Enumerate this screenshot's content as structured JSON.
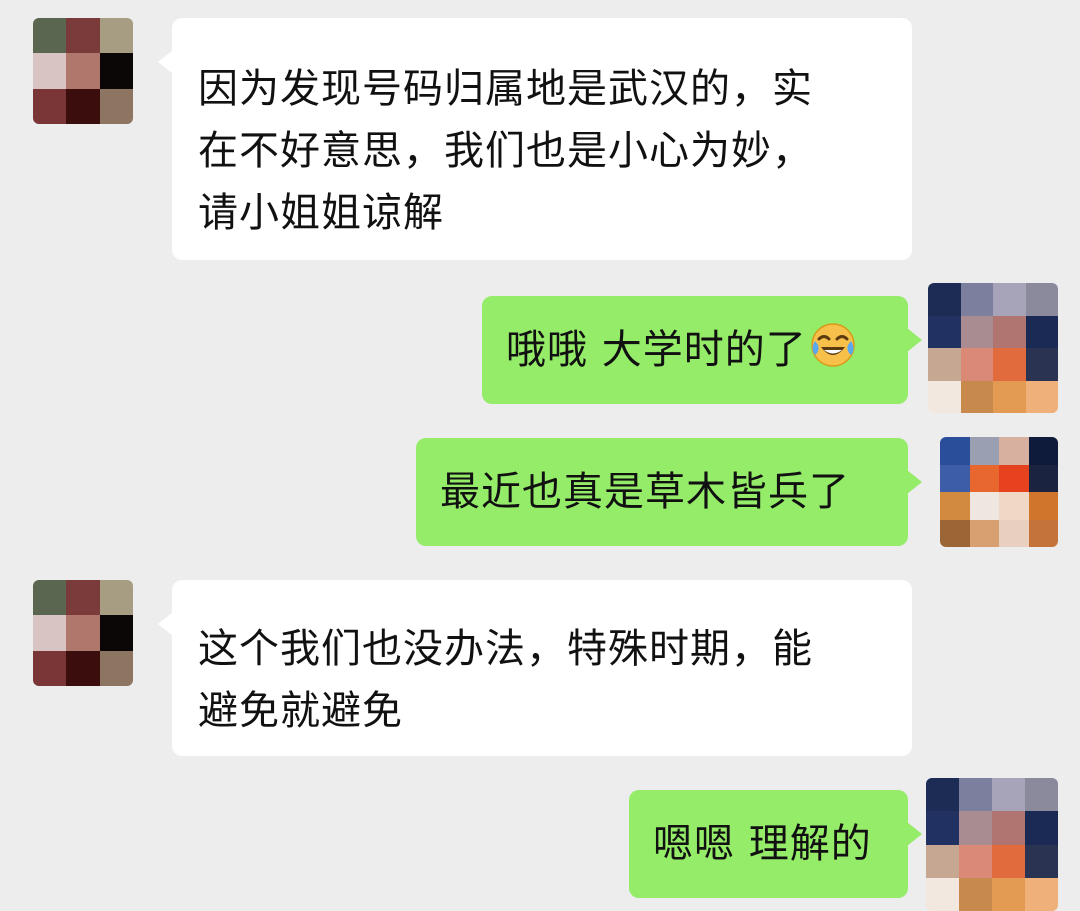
{
  "messages": [
    {
      "direction": "incoming",
      "lines": [
        "因为发现号码归属地是武汉的，实",
        "在不好意思，我们也是小心为妙，",
        "请小姐姐谅解"
      ]
    },
    {
      "direction": "outgoing",
      "text": "哦哦 大学时的了",
      "emoji": "face-with-tears-of-joy-icon"
    },
    {
      "direction": "outgoing",
      "text": "最近也真是草木皆兵了"
    },
    {
      "direction": "incoming",
      "lines": [
        "这个我们也没办法，特殊时期，能",
        "避免就避免"
      ]
    },
    {
      "direction": "outgoing",
      "text": "嗯嗯 理解的"
    }
  ],
  "colors": {
    "background": "#ededed",
    "incoming_bubble": "#ffffff",
    "outgoing_bubble": "#95ec69",
    "text": "#111111"
  }
}
